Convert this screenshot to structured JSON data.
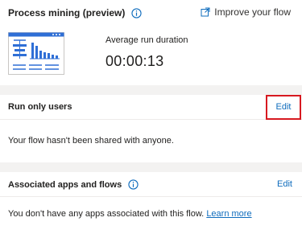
{
  "process_mining": {
    "title": "Process mining (preview)",
    "info_icon": "info-icon",
    "improve_link": "Improve your flow",
    "metric_label": "Average run duration",
    "metric_value": "00:00:13"
  },
  "run_only_users": {
    "title": "Run only users",
    "edit_label": "Edit",
    "message": "Your flow hasn't been shared with anyone."
  },
  "associated_apps": {
    "title": "Associated apps and flows",
    "edit_label": "Edit",
    "message": "You don't have any apps associated with this flow.",
    "learn_more": "Learn more"
  },
  "colors": {
    "link": "#0f6cbd",
    "highlight": "#d71920",
    "page_bg": "#f3f2f1"
  }
}
